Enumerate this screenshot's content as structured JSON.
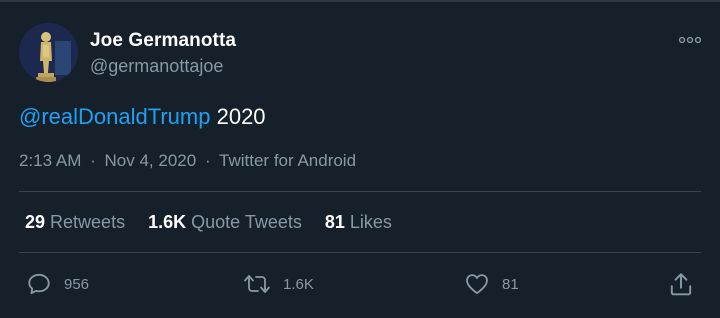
{
  "author": {
    "display_name": "Joe Germanotta",
    "handle": "@germanottajoe"
  },
  "tweet": {
    "mention": "@realDonaldTrump",
    "text": " 2020",
    "time": "2:13 AM",
    "date": "Nov 4, 2020",
    "source": "Twitter for Android",
    "separator": "·"
  },
  "stats": {
    "retweets_count": "29",
    "retweets_label": "Retweets",
    "quote_tweets_count": "1.6K",
    "quote_tweets_label": "Quote Tweets",
    "likes_count": "81",
    "likes_label": "Likes"
  },
  "actions": {
    "reply_count": "956",
    "retweet_count": "1.6K",
    "like_count": "81"
  },
  "icons": {
    "more": "more-horizontal-icon",
    "reply": "reply-icon",
    "retweet": "retweet-icon",
    "like": "heart-icon",
    "share": "share-icon"
  },
  "colors": {
    "background": "#15202b",
    "accent": "#1da1f2",
    "secondary_text": "#8899a6",
    "divider": "#38444d"
  }
}
